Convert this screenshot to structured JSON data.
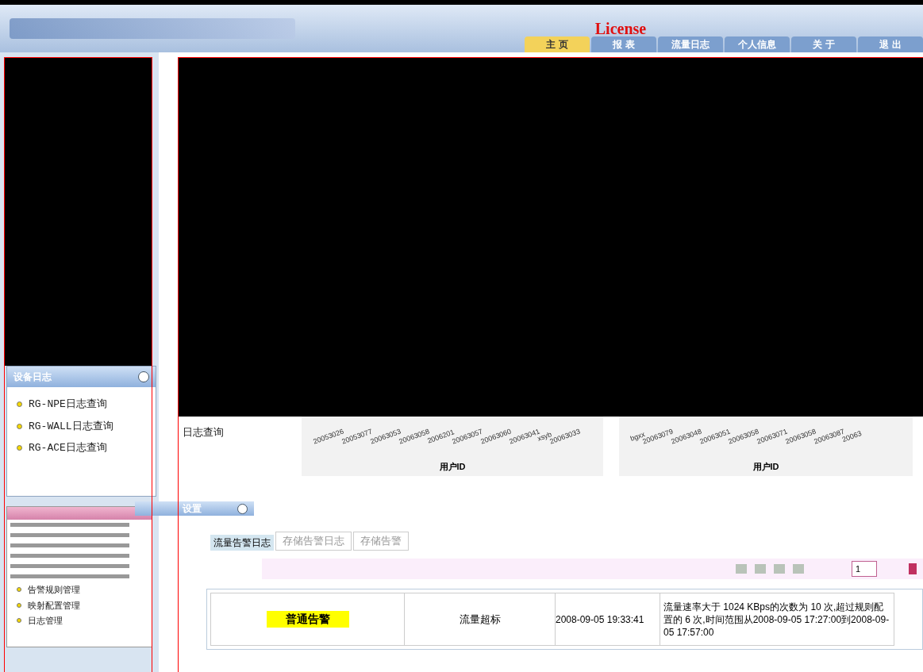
{
  "header": {
    "license": "License",
    "tabs": [
      {
        "label": "主 页",
        "selected": true
      },
      {
        "label": "报 表",
        "selected": false
      },
      {
        "label": "流量日志",
        "selected": false
      },
      {
        "label": "个人信息",
        "selected": false
      },
      {
        "label": "关 于",
        "selected": false
      },
      {
        "label": "退 出",
        "selected": false
      }
    ]
  },
  "device_log_panel": {
    "title": "设备日志",
    "items": [
      "RG-NPE日志查询",
      "RG-WALL日志查询",
      "RG-ACE日志查询"
    ]
  },
  "partial_link": "日志查询",
  "charts": [
    {
      "labels": [
        "20053026",
        "20053077",
        "20063053",
        "20063058",
        "2006201",
        "20063057",
        "20063060",
        "20063041",
        "xsyb",
        "20063033"
      ],
      "axis_label": "用户ID"
    },
    {
      "labels": [
        "bgxx",
        "20063079",
        "20063048",
        "20063051",
        "20063058",
        "20063071",
        "20063058",
        "20063087",
        "20063"
      ],
      "axis_label": "用户ID"
    }
  ],
  "settings_panel": {
    "title": "设置",
    "items": [
      "告警规则管理",
      "映射配置管理",
      "日志管理"
    ]
  },
  "log_tabs": [
    {
      "label": "流量告警日志",
      "selected": true
    },
    {
      "label": "存储告警日志",
      "selected": false
    },
    {
      "label": "存储告警",
      "selected": false
    }
  ],
  "pager": {
    "page": "1"
  },
  "table": {
    "rows": [
      {
        "level": "普通告警",
        "color": "#ffff00",
        "config": "流量超标",
        "time": "2008-09-05 19:33:41",
        "description": "流量速率大于 1024 KBps的次数为 10 次,超过规则配置的 6 次,时间范围从2008-09-05 17:27:00到2008-09-05 17:57:00"
      }
    ]
  }
}
